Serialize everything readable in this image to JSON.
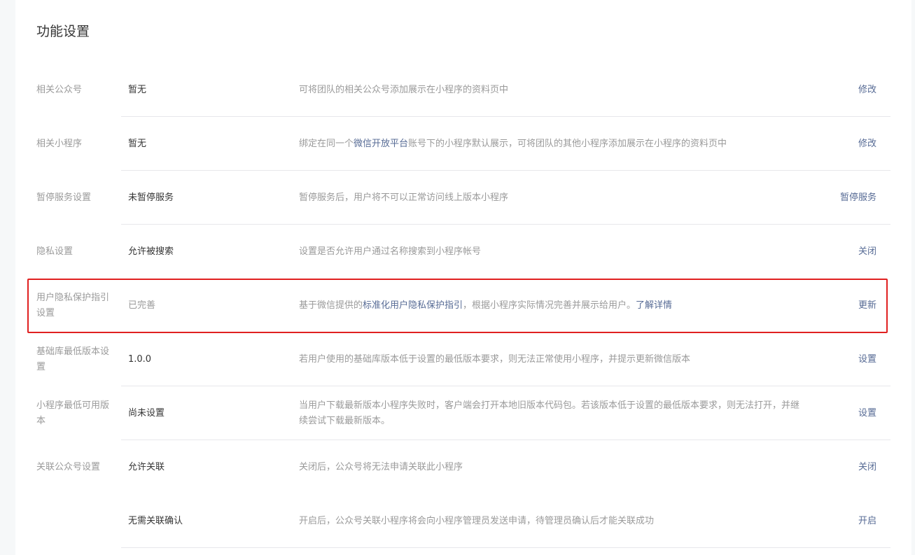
{
  "title": "功能设置",
  "rows": [
    {
      "label": "相关公众号",
      "value": "暂无",
      "desc": "可将团队的相关公众号添加展示在小程序的资料页中",
      "action": "修改"
    },
    {
      "label": "相关小程序",
      "value": "暂无",
      "desc_pre": "绑定在同一个",
      "desc_link": "微信开放平台",
      "desc_post": "账号下的小程序默认展示，可将团队的其他小程序添加展示在小程序的资料页中",
      "action": "修改"
    },
    {
      "label": "暂停服务设置",
      "value": "未暂停服务",
      "desc": "暂停服务后，用户将不可以正常访问线上版本小程序",
      "action": "暂停服务"
    },
    {
      "label": "隐私设置",
      "value": "允许被搜索",
      "desc": "设置是否允许用户通过名称搜索到小程序帐号",
      "action": "关闭"
    },
    {
      "label": "用户隐私保护指引设置",
      "value": "已完善",
      "desc_pre": "基于微信提供的",
      "desc_link": "标准化用户隐私保护指引",
      "desc_mid": "，根据小程序实际情况完善并展示给用户。",
      "desc_link2": "了解详情",
      "action": "更新"
    },
    {
      "label": "基础库最低版本设置",
      "value": "1.0.0",
      "desc": "若用户使用的基础库版本低于设置的最低版本要求，则无法正常使用小程序，并提示更新微信版本",
      "action": "设置"
    },
    {
      "label": "小程序最低可用版本",
      "value": "尚未设置",
      "desc": "当用户下载最新版本小程序失败时，客户端会打开本地旧版本代码包。若该版本低于设置的最低版本要求，则无法打开，并继续尝试下载最新版本。",
      "action": "设置"
    },
    {
      "label": "关联公众号设置",
      "value": "允许关联",
      "desc": "关闭后，公众号将无法申请关联此小程序",
      "action": "关闭"
    },
    {
      "label": "",
      "value": "无需关联确认",
      "desc": "开启后，公众号关联小程序将会向小程序管理员发送申请，待管理员确认后才能关联成功",
      "action": "开启"
    }
  ],
  "colors": {
    "link": "#576b95",
    "highlight_border": "#e02020",
    "muted_text": "#9a9a9a",
    "divider": "#e7e7eb"
  }
}
